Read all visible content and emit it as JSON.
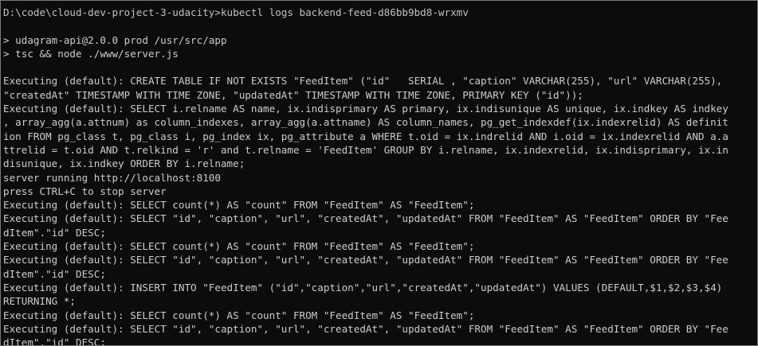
{
  "terminal": {
    "lines": [
      "D:\\code\\cloud-dev-project-3-udacity>kubectl logs backend-feed-d86bb9bd8-wrxmv",
      "",
      "> udagram-api@2.0.0 prod /usr/src/app",
      "> tsc && node ./www/server.js",
      "",
      "Executing (default): CREATE TABLE IF NOT EXISTS \"FeedItem\" (\"id\"   SERIAL , \"caption\" VARCHAR(255), \"url\" VARCHAR(255),",
      "\"createdAt\" TIMESTAMP WITH TIME ZONE, \"updatedAt\" TIMESTAMP WITH TIME ZONE, PRIMARY KEY (\"id\"));",
      "Executing (default): SELECT i.relname AS name, ix.indisprimary AS primary, ix.indisunique AS unique, ix.indkey AS indkey",
      ", array_agg(a.attnum) as column_indexes, array_agg(a.attname) AS column_names, pg_get_indexdef(ix.indexrelid) AS definit",
      "ion FROM pg_class t, pg_class i, pg_index ix, pg_attribute a WHERE t.oid = ix.indrelid AND i.oid = ix.indexrelid AND a.a",
      "ttrelid = t.oid AND t.relkind = 'r' and t.relname = 'FeedItem' GROUP BY i.relname, ix.indexrelid, ix.indisprimary, ix.in",
      "disunique, ix.indkey ORDER BY i.relname;",
      "server running http://localhost:8100",
      "press CTRL+C to stop server",
      "Executing (default): SELECT count(*) AS \"count\" FROM \"FeedItem\" AS \"FeedItem\";",
      "Executing (default): SELECT \"id\", \"caption\", \"url\", \"createdAt\", \"updatedAt\" FROM \"FeedItem\" AS \"FeedItem\" ORDER BY \"Fee",
      "dItem\".\"id\" DESC;",
      "Executing (default): SELECT count(*) AS \"count\" FROM \"FeedItem\" AS \"FeedItem\";",
      "Executing (default): SELECT \"id\", \"caption\", \"url\", \"createdAt\", \"updatedAt\" FROM \"FeedItem\" AS \"FeedItem\" ORDER BY \"Fee",
      "dItem\".\"id\" DESC;",
      "Executing (default): INSERT INTO \"FeedItem\" (\"id\",\"caption\",\"url\",\"createdAt\",\"updatedAt\") VALUES (DEFAULT,$1,$2,$3,$4)",
      "RETURNING *;",
      "Executing (default): SELECT count(*) AS \"count\" FROM \"FeedItem\" AS \"FeedItem\";",
      "Executing (default): SELECT \"id\", \"caption\", \"url\", \"createdAt\", \"updatedAt\" FROM \"FeedItem\" AS \"FeedItem\" ORDER BY \"Fee",
      "dItem\".\"id\" DESC;"
    ]
  },
  "colors": {
    "background": "#0c0c0c",
    "text": "#cccccc",
    "border": "#7a7a7a"
  }
}
